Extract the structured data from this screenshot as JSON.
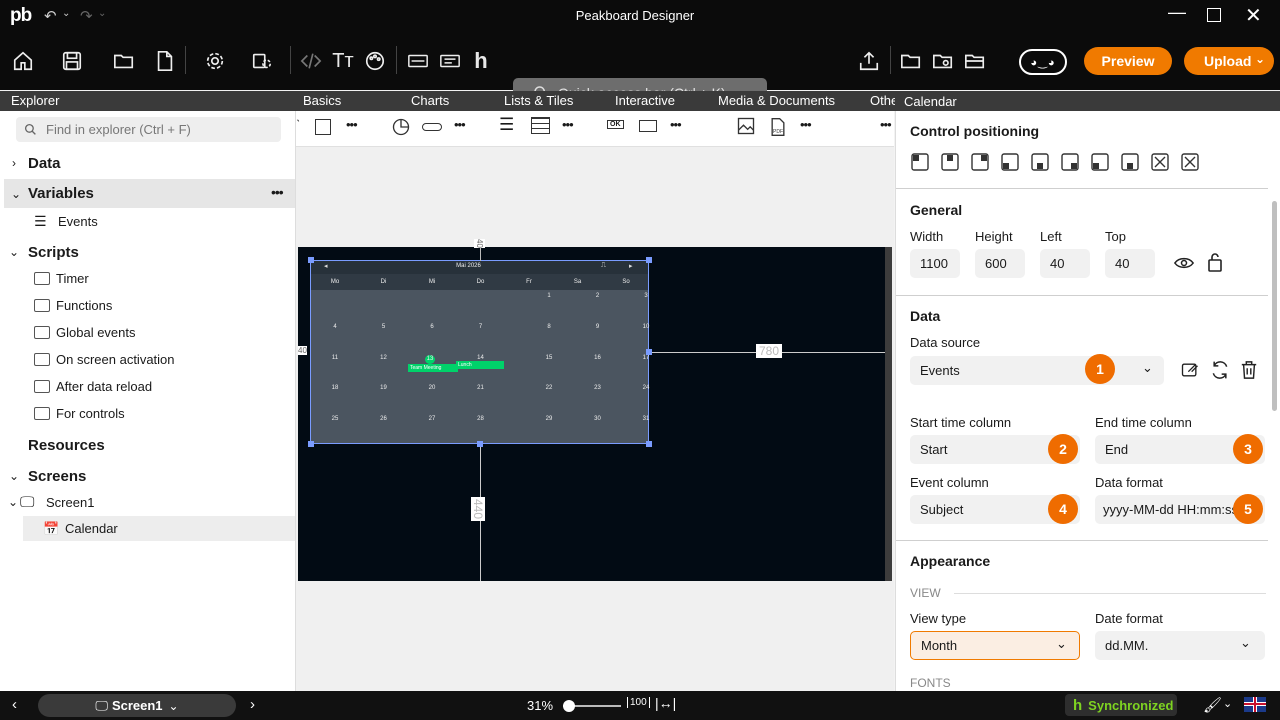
{
  "window": {
    "title": "Peakboard Designer",
    "logo": "pb"
  },
  "toolbar": {
    "quick_access_placeholder": "Quick access bar (Ctrl + K)",
    "preview_label": "Preview",
    "upload_label": "Upload"
  },
  "ribbon": {
    "tabs": [
      "Basics",
      "Charts",
      "Lists & Tiles",
      "Interactive",
      "Media & Documents",
      "Othe"
    ]
  },
  "explorer": {
    "title": "Explorer",
    "search_placeholder": "Find in explorer (Ctrl + F)",
    "data_label": "Data",
    "variables_label": "Variables",
    "events_label": "Events",
    "scripts_label": "Scripts",
    "scripts_items": [
      "Timer",
      "Functions",
      "Global events",
      "On screen activation",
      "After data reload",
      "For controls"
    ],
    "resources_label": "Resources",
    "screens_label": "Screens",
    "screen1_label": "Screen1",
    "calendar_label": "Calendar"
  },
  "canvas": {
    "dim_top": "40",
    "dim_left": "40",
    "dim_right": "780",
    "dim_bottom": "440",
    "calendar": {
      "month_label": "Mai 2026",
      "weekdays": [
        "Mo",
        "Di",
        "Mi",
        "Do",
        "Fr",
        "Sa",
        "So"
      ],
      "rows": [
        [
          "",
          "",
          "",
          "",
          "1",
          "2",
          "3"
        ],
        [
          "4",
          "5",
          "6",
          "7",
          "8",
          "9",
          "10"
        ],
        [
          "11",
          "12",
          "13",
          "14",
          "15",
          "16",
          "17"
        ],
        [
          "18",
          "19",
          "20",
          "21",
          "22",
          "23",
          "24"
        ],
        [
          "25",
          "26",
          "27",
          "28",
          "29",
          "30",
          "31"
        ]
      ],
      "event1": "Team Meeting",
      "event2": "Lunch",
      "today": "13"
    }
  },
  "properties": {
    "panel_title": "Calendar",
    "control_positioning": "Control positioning",
    "general_title": "General",
    "width_label": "Width",
    "width_value": "1100",
    "height_label": "Height",
    "height_value": "600",
    "left_label": "Left",
    "left_value": "40",
    "top_label": "Top",
    "top_value": "40",
    "data_title": "Data",
    "data_source_label": "Data source",
    "data_source_value": "Events",
    "start_label": "Start time column",
    "start_value": "Start",
    "end_label": "End time column",
    "end_value": "End",
    "event_label": "Event column",
    "event_value": "Subject",
    "format_label": "Data format",
    "format_value": "yyyy-MM-dd HH:mm:ss",
    "appearance_title": "Appearance",
    "view_subtitle": "VIEW",
    "view_type_label": "View type",
    "view_type_value": "Month",
    "date_format_label": "Date format",
    "date_format_value": "dd.MM.",
    "fonts_subtitle": "FONTS",
    "badges": [
      "1",
      "2",
      "3",
      "4",
      "5"
    ]
  },
  "statusbar": {
    "screen_label": "Screen1",
    "zoom": "31%",
    "zoom_fraction": 0.31,
    "sync_label": "Synchronized"
  },
  "colors": {
    "accent": "#f07a00",
    "sync": "#7ed321",
    "event": "#00d26a"
  }
}
